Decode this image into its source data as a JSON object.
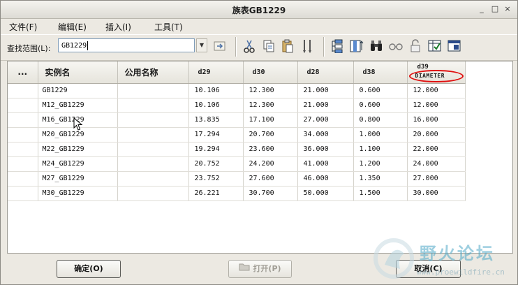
{
  "window": {
    "title": "族表GB1229",
    "min_label": "_",
    "max_label": "□",
    "close_label": "×"
  },
  "menu": [
    "文件(F)",
    "编辑(E)",
    "插入(I)",
    "工具(T)"
  ],
  "find": {
    "label": "查找范围(L):",
    "value": "GB1229"
  },
  "toolbar_icons": [
    "select-icon",
    "cut-icon",
    "copy-icon",
    "paste-icon",
    "fill-icon",
    "tree-icon",
    "insert-column-icon",
    "binoculars-icon",
    "glasses-icon",
    "lock-icon",
    "verify-icon",
    "preview-icon"
  ],
  "table": {
    "headers": [
      "...",
      "实例名",
      "公用名称",
      "d29",
      "d30",
      "d28",
      "d38"
    ],
    "last_header": {
      "name": "d39",
      "sub": "DIAMETER"
    },
    "rows": [
      [
        "",
        "GB1229",
        "",
        "10.106",
        "12.300",
        "21.000",
        "0.600",
        "12.000"
      ],
      [
        "",
        "M12_GB1229",
        "",
        "10.106",
        "12.300",
        "21.000",
        "0.600",
        "12.000"
      ],
      [
        "",
        "M16_GB1229",
        "",
        "13.835",
        "17.100",
        "27.000",
        "0.800",
        "16.000"
      ],
      [
        "",
        "M20_GB1229",
        "",
        "17.294",
        "20.700",
        "34.000",
        "1.000",
        "20.000"
      ],
      [
        "",
        "M22_GB1229",
        "",
        "19.294",
        "23.600",
        "36.000",
        "1.100",
        "22.000"
      ],
      [
        "",
        "M24_GB1229",
        "",
        "20.752",
        "24.200",
        "41.000",
        "1.200",
        "24.000"
      ],
      [
        "",
        "M27_GB1229",
        "",
        "23.752",
        "27.600",
        "46.000",
        "1.350",
        "27.000"
      ],
      [
        "",
        "M30_GB1229",
        "",
        "26.221",
        "30.700",
        "50.000",
        "1.500",
        "30.000"
      ]
    ]
  },
  "buttons": {
    "ok": "确定(O)",
    "open": "打开(P)",
    "cancel": "取消(C)"
  },
  "watermark": {
    "text": "野火论坛",
    "url": "www.proewildfire.cn"
  },
  "colors": {
    "highlight": "#e01010",
    "accent": "#4fa8c8"
  }
}
